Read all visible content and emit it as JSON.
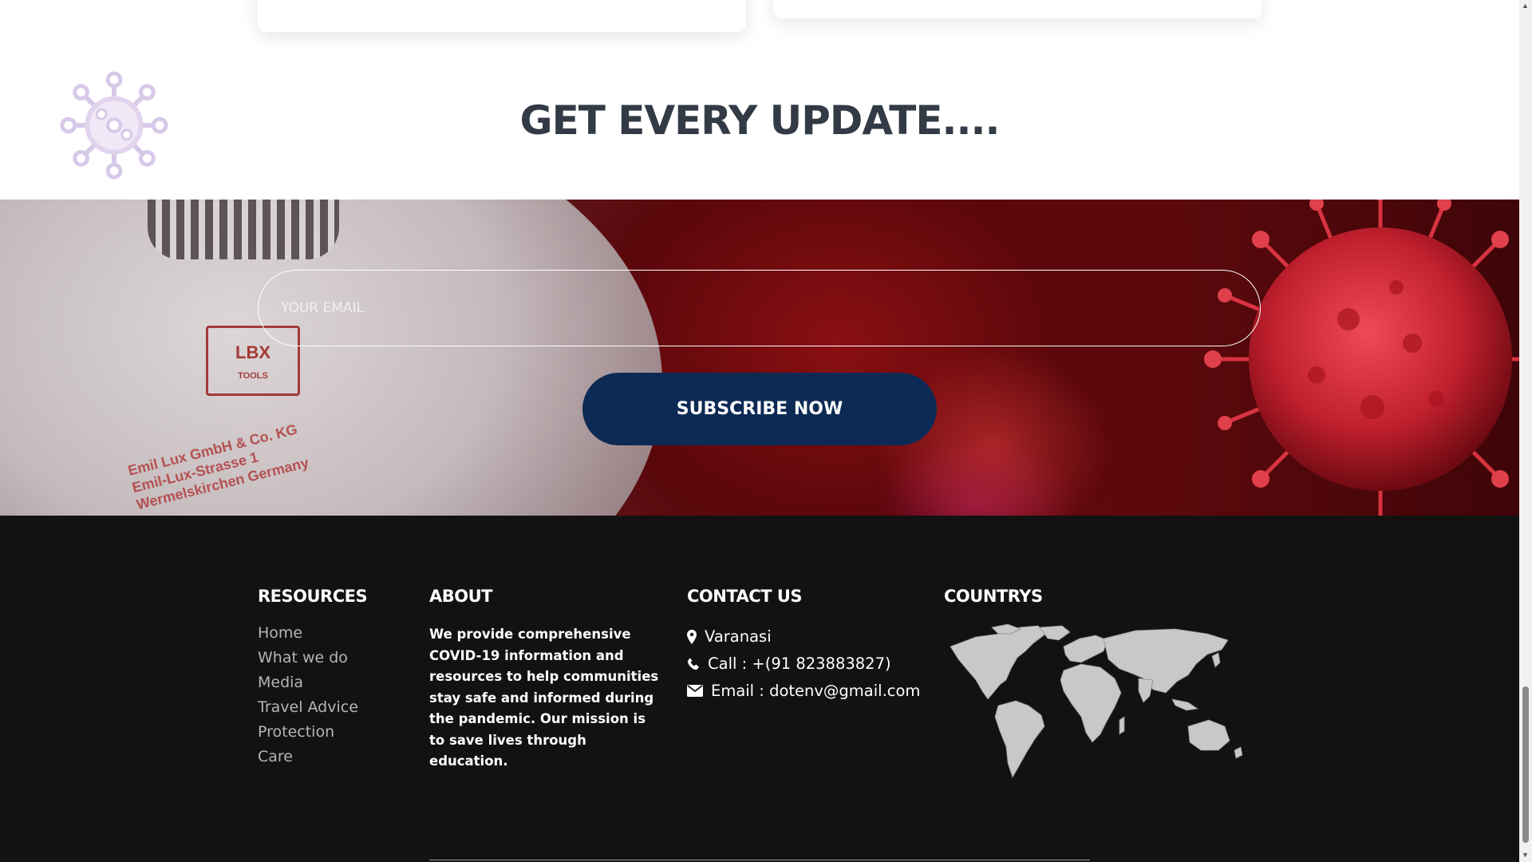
{
  "section": {
    "title": "GET EVERY UPDATE...."
  },
  "subscribe": {
    "email_placeholder": "YOUR EMAIL",
    "button_label": "SUBSCRIBE NOW"
  },
  "hero_mask_text": {
    "brand_mark": "LBX",
    "brand_tools": "TOOLS",
    "line1": "Emil Lux GmbH & Co. KG",
    "line2": "Emil-Lux-Strasse 1",
    "line3": "Wermelskirchen Germany"
  },
  "footer": {
    "resources": {
      "title": "RESOURCES",
      "items": [
        "Home",
        "What we do",
        "Media",
        "Travel Advice",
        "Protection",
        "Care"
      ]
    },
    "about": {
      "title": "ABOUT",
      "text": "We provide comprehensive COVID-19 information and resources to help communities stay safe and informed during the pandemic. Our mission is to save lives through education."
    },
    "contact": {
      "title": "CONTACT US",
      "location": "Varanasi",
      "phone": "Call : +(91 823883827)",
      "email": "Email : dotenv@gmail.com"
    },
    "countries": {
      "title": "COUNTRYS"
    }
  },
  "icons": {
    "virus": "virus-icon",
    "location": "location-pin-icon",
    "phone": "phone-icon",
    "email": "envelope-icon",
    "map": "world-map-icon"
  },
  "colors": {
    "title_text": "#323a45",
    "button_bg": "#0c2a54",
    "footer_bg": "#121212",
    "hero_red": "#8a0f12"
  }
}
